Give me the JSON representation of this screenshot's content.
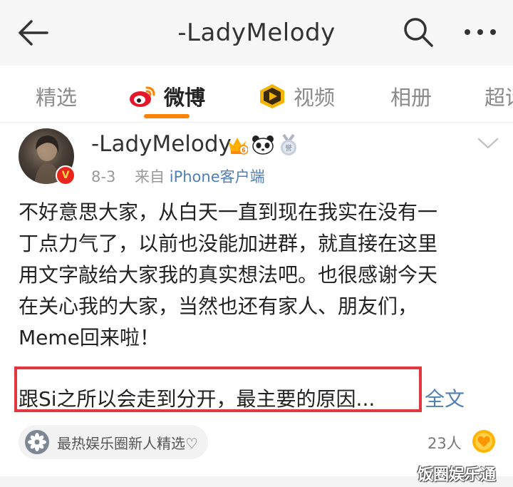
{
  "header": {
    "title": "-LadyMelody",
    "back_icon": "back-arrow-icon",
    "search_icon": "search-icon",
    "more_icon": "more-dots-icon"
  },
  "tabs": [
    {
      "label": "精选",
      "active": false
    },
    {
      "label": "微博",
      "active": true,
      "icon": "weibo-logo-icon"
    },
    {
      "label": "视频",
      "active": false,
      "icon": "video-play-icon"
    },
    {
      "label": "相册",
      "active": false
    },
    {
      "label": "超话",
      "active": false
    }
  ],
  "colors": {
    "accent": "#ff8200",
    "link": "#4f7fb5",
    "highlight_border": "#e0383e"
  },
  "post": {
    "username": "-LadyMelody",
    "badges": [
      "vip-crown-icon",
      "panda-icon",
      "medal-icon"
    ],
    "date": "8-3",
    "source_prefix": "来自",
    "source": "iPhone客户端",
    "lines": [
      "不好意思大家，从白天一直到现在我实在没有一",
      "丁点力气了，以前也没能加进群，就直接在这里",
      "用文字敲给大家我的真实想法吧。也很感谢今天",
      "在关心我的大家，当然也还有家人、朋友们，",
      "Meme回来啦！"
    ],
    "preview": "跟Si之所以会走到分开，最主要的原因...",
    "full_text_link": "全文"
  },
  "footer": {
    "chip_label": "最热娱乐圈新人精选♡",
    "people_count": "23人"
  },
  "watermark": "饭圈娱乐通"
}
